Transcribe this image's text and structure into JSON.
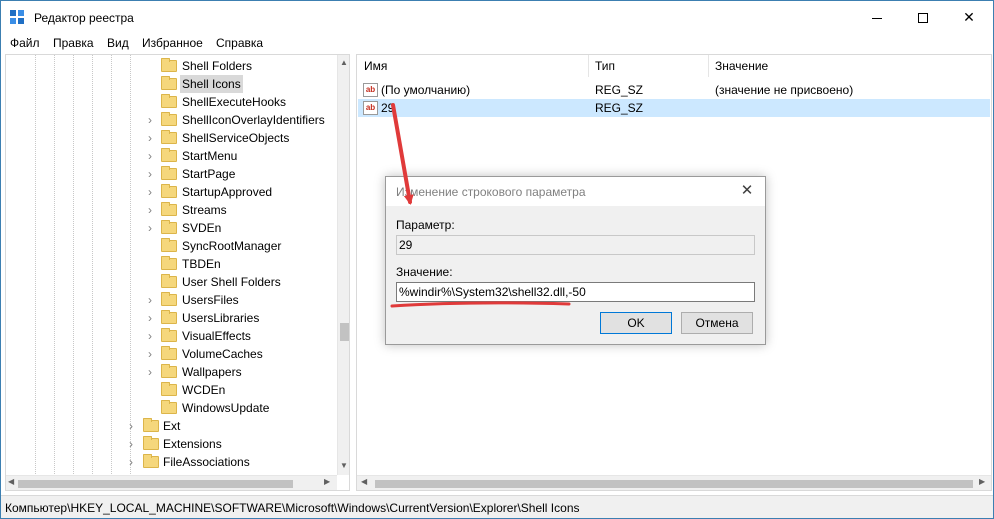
{
  "window": {
    "title": "Редактор реестра",
    "minimize_icon": "minimize-icon",
    "maximize_icon": "maximize-icon",
    "close_glyph": "✕"
  },
  "menu": {
    "items": [
      {
        "label": "Файл"
      },
      {
        "label": "Правка"
      },
      {
        "label": "Вид"
      },
      {
        "label": "Избранное"
      },
      {
        "label": "Справка"
      }
    ]
  },
  "tree": {
    "items": [
      {
        "label": "Shell Folders",
        "expandable": false,
        "selected": false
      },
      {
        "label": "Shell Icons",
        "expandable": false,
        "selected": true
      },
      {
        "label": "ShellExecuteHooks",
        "expandable": false,
        "selected": false
      },
      {
        "label": "ShellIconOverlayIdentifiers",
        "expandable": true,
        "selected": false
      },
      {
        "label": "ShellServiceObjects",
        "expandable": true,
        "selected": false
      },
      {
        "label": "StartMenu",
        "expandable": true,
        "selected": false
      },
      {
        "label": "StartPage",
        "expandable": true,
        "selected": false
      },
      {
        "label": "StartupApproved",
        "expandable": true,
        "selected": false
      },
      {
        "label": "Streams",
        "expandable": true,
        "selected": false
      },
      {
        "label": "SVDEn",
        "expandable": true,
        "selected": false
      },
      {
        "label": "SyncRootManager",
        "expandable": false,
        "selected": false
      },
      {
        "label": "TBDEn",
        "expandable": false,
        "selected": false
      },
      {
        "label": "User Shell Folders",
        "expandable": false,
        "selected": false
      },
      {
        "label": "UsersFiles",
        "expandable": true,
        "selected": false
      },
      {
        "label": "UsersLibraries",
        "expandable": true,
        "selected": false
      },
      {
        "label": "VisualEffects",
        "expandable": true,
        "selected": false
      },
      {
        "label": "VolumeCaches",
        "expandable": true,
        "selected": false
      },
      {
        "label": "Wallpapers",
        "expandable": true,
        "selected": false
      },
      {
        "label": "WCDEn",
        "expandable": false,
        "selected": false
      },
      {
        "label": "WindowsUpdate",
        "expandable": false,
        "selected": false
      },
      {
        "label": "Ext",
        "expandable": true,
        "selected": false
      },
      {
        "label": "Extensions",
        "expandable": true,
        "selected": false
      },
      {
        "label": "FileAssociations",
        "expandable": true,
        "selected": false
      }
    ]
  },
  "list": {
    "columns": [
      {
        "label": "Имя"
      },
      {
        "label": "Тип"
      },
      {
        "label": "Значение"
      }
    ],
    "rows": [
      {
        "name": "(По умолчанию)",
        "type": "REG_SZ",
        "value": "(значение не присвоено)",
        "icon": "string-value-icon",
        "selected": false
      },
      {
        "name": "29",
        "type": "REG_SZ",
        "value": "",
        "icon": "string-value-icon",
        "selected": true
      }
    ],
    "icon_text": "ab"
  },
  "dialog": {
    "title": "Изменение строкового параметра",
    "param_label": "Параметр:",
    "param_value": "29",
    "value_label": "Значение:",
    "value_text": "%windir%\\System32\\shell32.dll,-50",
    "ok_label": "OK",
    "cancel_label": "Отмена",
    "close_glyph": "✕"
  },
  "statusbar": {
    "path": "Компьютер\\HKEY_LOCAL_MACHINE\\SOFTWARE\\Microsoft\\Windows\\CurrentVersion\\Explorer\\Shell Icons"
  },
  "annotation": {
    "color": "#e03a3a"
  }
}
